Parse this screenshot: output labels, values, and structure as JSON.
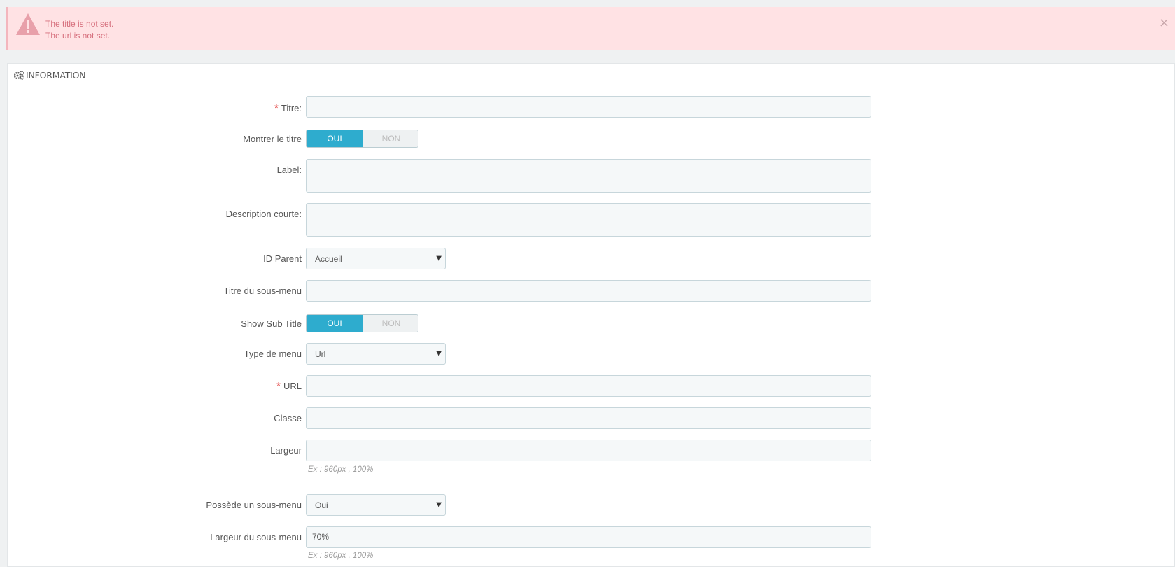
{
  "alert": {
    "messages": [
      "The title is not set.",
      "The url is not set."
    ],
    "close_label": "×",
    "background": "#ffe2e4",
    "text_color": "#d66e7c"
  },
  "panel": {
    "icon": "cogs-icon",
    "title": "INFORMATION"
  },
  "form": {
    "title": {
      "label": "Titre:",
      "required_mark": "*",
      "value": ""
    },
    "show_title": {
      "label": "Montrer le titre",
      "on": "OUI",
      "off": "NON",
      "selected": "OUI"
    },
    "label_field": {
      "label": "Label:",
      "value": ""
    },
    "short_description": {
      "label": "Description courte:",
      "value": ""
    },
    "parent_id": {
      "label": "ID Parent",
      "value": "Accueil"
    },
    "submenu_title": {
      "label": "Titre du sous-menu",
      "value": ""
    },
    "show_sub_title": {
      "label": "Show Sub Title",
      "on": "OUI",
      "off": "NON",
      "selected": "OUI"
    },
    "menu_type": {
      "label": "Type de menu",
      "value": "Url"
    },
    "url": {
      "label": "URL",
      "required_mark": "*",
      "value": ""
    },
    "class": {
      "label": "Classe",
      "value": ""
    },
    "width": {
      "label": "Largeur",
      "value": "",
      "help": "Ex : 960px , 100%"
    },
    "has_submenu": {
      "label": "Possède un sous-menu",
      "value": "Oui"
    },
    "submenu_width": {
      "label": "Largeur du sous-menu",
      "value": "70%",
      "help": "Ex : 960px , 100%"
    }
  },
  "colors": {
    "accent": "#2eacce",
    "required": "#e4504f",
    "page_bg": "#eff1f2"
  }
}
